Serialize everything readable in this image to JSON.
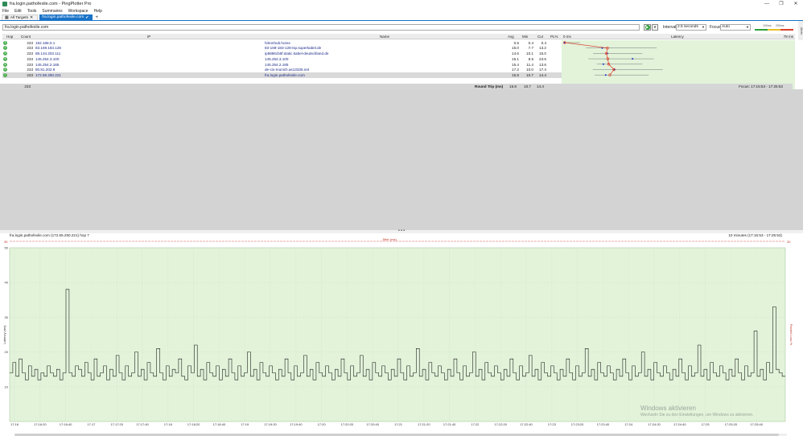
{
  "window": {
    "title": "fra.login.pathofexile.com - PingPlotter Pro",
    "controls": {
      "minimize": "—",
      "maximize": "❐",
      "close": "✕"
    }
  },
  "menu": [
    "File",
    "Edit",
    "Tools",
    "Summaries",
    "Workspace",
    "Help"
  ],
  "tabs": [
    {
      "label": "All Targets",
      "active": false
    },
    {
      "label": "fra.login.pathofexile.com",
      "active": true
    }
  ],
  "toolbar": {
    "target": "fra.login.pathofexile.com",
    "interval_label": "Interval",
    "interval_value": "2.5 seconds",
    "focus_label": "Focus",
    "focus_value": "Auto",
    "scale_labels": [
      "100ms",
      "200ms"
    ],
    "side_tab": "Alerts"
  },
  "grid": {
    "headers": {
      "hop": "Hop",
      "count": "Count",
      "ip": "IP",
      "name": "Name",
      "avg": "Avg",
      "min": "Min",
      "cur": "Cur",
      "pl": "PL%",
      "latency_left": "0 ms",
      "latency": "Latency",
      "latency_right": "78 ms"
    },
    "rows": [
      {
        "hop": "1",
        "count": "233",
        "ip": "192.168.0.1",
        "name": "hitronhub.home",
        "avg": "0.5",
        "min": "0.4",
        "cur": "0.4",
        "pl": ""
      },
      {
        "hop": "2",
        "count": "233",
        "ip": "83.169.183.128",
        "name": "83-169-183-128-isp.superkabel.de",
        "avg": "15.0",
        "min": "7.7",
        "cur": "13.2",
        "pl": ""
      },
      {
        "hop": "3",
        "count": "233",
        "ip": "88.134.203.111",
        "name": "ip5886cb6f.static.kabel-deutschland.de",
        "avg": "14.6",
        "min": "10.1",
        "cur": "15.0",
        "pl": ""
      },
      {
        "hop": "4",
        "count": "233",
        "ip": "145.254.3.100",
        "name": "145.254.3.100",
        "avg": "15.1",
        "min": "8.5",
        "cur": "23.5",
        "pl": ""
      },
      {
        "hop": "5",
        "count": "233",
        "ip": "145.254.2.185",
        "name": "145.254.2.185",
        "avg": "15.4",
        "min": "11.4",
        "cur": "13.6",
        "pl": ""
      },
      {
        "hop": "6",
        "count": "233",
        "ip": "80.81.202.9",
        "name": "de-cix-munich.as13335.net",
        "avg": "17.2",
        "min": "10.0",
        "cur": "17.4",
        "pl": ""
      },
      {
        "hop": "7",
        "count": "233",
        "ip": "172.65.250.221",
        "name": "fra.login.pathofexile.com",
        "avg": "15.8",
        "min": "10.7",
        "cur": "14.4",
        "pl": ""
      }
    ],
    "round_trip": {
      "count": "233",
      "label": "Round Trip (ms)",
      "avg": "15.8",
      "min": "10.7",
      "cur": "14.4",
      "focus": "Focus: 17:15:53 - 17:25:53"
    }
  },
  "timeline": {
    "title": "fra.login.pathofexile.com (172.65.250.221) hop 7",
    "range": "10 minutes (17:15:53 - 17:25:53)",
    "jitter_label": "Jitter (ms)",
    "top_left": "35",
    "top_right": "30",
    "y_left_label": "Latency (ms)",
    "y_right_label": "Packet Loss %",
    "watermark_title": "Windows aktivieren",
    "watermark_text": "Wechseln Sie zu den Einstellungen, um Windows zu aktivieren."
  },
  "chart_data": [
    {
      "type": "scatter",
      "title": "Latency",
      "x_range": [
        0,
        78
      ],
      "series": [
        {
          "name": "avg",
          "values": [
            0.5,
            15.0,
            14.6,
            15.1,
            15.4,
            17.2,
            15.8
          ]
        },
        {
          "name": "min",
          "values": [
            0.4,
            7.7,
            10.1,
            8.5,
            11.4,
            10.0,
            10.7
          ]
        },
        {
          "name": "cur",
          "values": [
            0.4,
            13.2,
            15.0,
            23.5,
            13.6,
            17.4,
            14.4
          ]
        }
      ]
    },
    {
      "type": "line",
      "ylabel": "Latency (ms)",
      "ylim": [
        0,
        50
      ],
      "yticks": [
        10,
        20,
        30,
        40,
        50
      ],
      "xlabels": [
        "17:16",
        "17:16:20",
        "17:16:40",
        "17:17",
        "17:17:20",
        "17:17:40",
        "17:18",
        "17:18:20",
        "17:18:40",
        "17:19",
        "17:19:20",
        "17:19:40",
        "17:20",
        "17:20:20",
        "17:20:40",
        "17:21",
        "17:21:20",
        "17:21:40",
        "17:22",
        "17:22:20",
        "17:22:40",
        "17:23",
        "17:23:20",
        "17:23:40",
        "17:24",
        "17:24:20",
        "17:24:40",
        "17:25",
        "17:25:20",
        "17:25:40"
      ],
      "values": [
        14,
        17,
        13,
        18,
        14,
        12,
        16,
        13,
        15,
        12,
        14,
        13,
        16,
        14,
        13,
        15,
        12,
        14,
        38,
        14,
        13,
        16,
        15,
        13,
        17,
        14,
        12,
        18,
        13,
        14,
        16,
        12,
        15,
        13,
        19,
        14,
        12,
        16,
        13,
        14,
        20,
        13,
        15,
        12,
        17,
        14,
        13,
        21,
        14,
        12,
        16,
        13,
        15,
        14,
        18,
        13,
        12,
        16,
        14,
        22,
        13,
        15,
        12,
        17,
        14,
        13,
        16,
        12,
        15,
        13,
        18,
        14,
        12,
        16,
        13,
        14,
        20,
        13,
        15,
        12,
        17,
        14,
        13,
        16,
        14,
        12,
        15,
        13,
        18,
        14,
        12,
        16,
        13,
        14,
        19,
        13,
        15,
        12,
        17,
        14,
        13,
        16,
        14,
        12,
        15,
        13,
        18,
        14,
        12,
        16,
        13,
        14,
        19,
        13,
        15,
        12,
        17,
        14,
        13,
        16,
        14,
        12,
        15,
        13,
        18,
        14,
        12,
        16,
        13,
        14,
        21,
        13,
        15,
        12,
        17,
        14,
        13,
        16,
        14,
        12,
        15,
        13,
        18,
        14,
        12,
        16,
        13,
        14,
        20,
        13,
        15,
        12,
        17,
        14,
        13,
        16,
        14,
        12,
        15,
        13,
        18,
        14,
        12,
        16,
        13,
        14,
        19,
        13,
        15,
        12,
        17,
        14,
        13,
        16,
        14,
        12,
        15,
        13,
        18,
        14,
        12,
        16,
        13,
        14,
        21,
        13,
        15,
        12,
        17,
        14,
        13,
        16,
        14,
        12,
        15,
        13,
        18,
        14,
        12,
        16,
        13,
        14,
        20,
        13,
        15,
        12,
        17,
        14,
        13,
        16,
        14,
        12,
        15,
        13,
        18,
        14,
        12,
        16,
        13,
        14,
        22,
        13,
        15,
        12,
        17,
        14,
        13,
        16,
        14,
        12,
        15,
        13,
        18,
        14,
        12,
        16,
        13,
        14,
        26,
        13,
        15,
        12,
        17,
        14,
        33,
        15,
        14,
        13
      ]
    }
  ],
  "colors": {
    "accent": "#1a73c7",
    "chart_bg": "#e2f3da",
    "hop_ok": "#4caf50",
    "line": "#111111",
    "redline": "#d9534f",
    "avg_dot": "#1c2bc7",
    "cur_dot": "#e0402f"
  }
}
